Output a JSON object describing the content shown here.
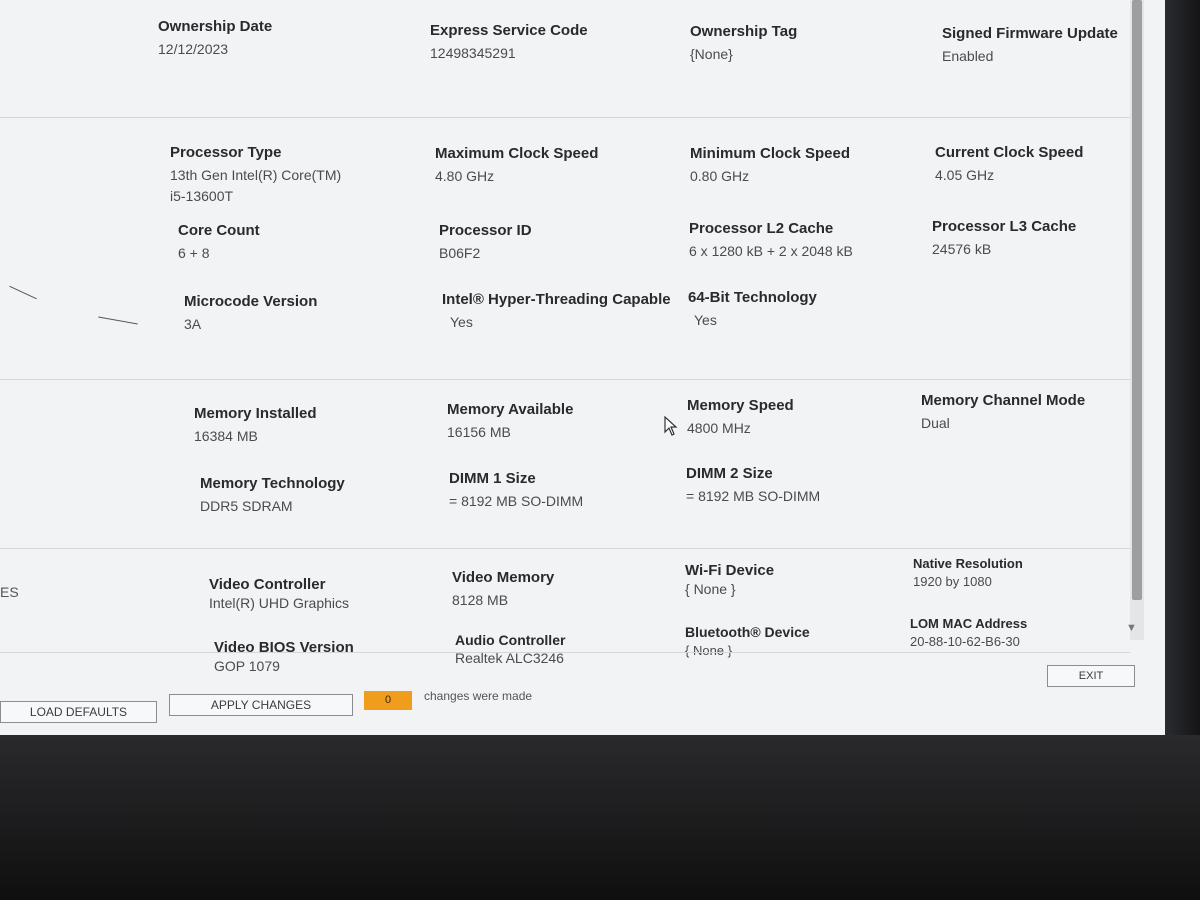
{
  "ownership": {
    "ownership_date": {
      "label": "Ownership Date",
      "value": "12/12/2023"
    },
    "express_service_code": {
      "label": "Express Service Code",
      "value": "12498345291"
    },
    "ownership_tag": {
      "label": "Ownership Tag",
      "value": "{None}"
    },
    "signed_firmware_update": {
      "label": "Signed Firmware Update",
      "value": "Enabled"
    }
  },
  "processor": {
    "processor_type": {
      "label": "Processor Type",
      "value_line1": "13th Gen Intel(R) Core(TM)",
      "value_line2": "i5-13600T"
    },
    "maximum_clock_speed": {
      "label": "Maximum Clock Speed",
      "value": "4.80 GHz"
    },
    "minimum_clock_speed": {
      "label": "Minimum Clock Speed",
      "value": "0.80 GHz"
    },
    "current_clock_speed": {
      "label": "Current Clock Speed",
      "value": "4.05 GHz"
    },
    "core_count": {
      "label": "Core Count",
      "value": "6 + 8"
    },
    "processor_id": {
      "label": "Processor ID",
      "value": "B06F2"
    },
    "l2_cache": {
      "label": "Processor L2 Cache",
      "value": "6 x 1280  kB + 2 x 2048  kB"
    },
    "l3_cache": {
      "label": "Processor L3 Cache",
      "value": "24576 kB"
    },
    "microcode_version": {
      "label": "Microcode Version",
      "value": "3A"
    },
    "hyper_threading": {
      "label": "Intel® Hyper-Threading Capable",
      "value": "Yes"
    },
    "sixty_four_bit": {
      "label": "64-Bit Technology",
      "value": "Yes"
    }
  },
  "memory": {
    "installed": {
      "label": "Memory Installed",
      "value": "16384 MB"
    },
    "available": {
      "label": "Memory Available",
      "value": "16156 MB"
    },
    "speed": {
      "label": "Memory Speed",
      "value": "4800 MHz"
    },
    "channel_mode": {
      "label": "Memory Channel Mode",
      "value": "Dual"
    },
    "technology": {
      "label": "Memory Technology",
      "value": "DDR5 SDRAM"
    },
    "dimm1": {
      "label": "DIMM 1 Size",
      "value": "= 8192 MB SO-DIMM"
    },
    "dimm2": {
      "label": "DIMM 2 Size",
      "value": "= 8192 MB SO-DIMM"
    }
  },
  "devices": {
    "video_controller": {
      "label": "Video Controller",
      "value": "Intel(R) UHD Graphics"
    },
    "video_memory": {
      "label": "Video Memory",
      "value": "8128 MB"
    },
    "wifi_device": {
      "label": "Wi-Fi Device",
      "value": "{ None }"
    },
    "native_resolution": {
      "label": "Native Resolution",
      "value": "1920 by 1080"
    },
    "video_bios": {
      "label": "Video BIOS Version",
      "value": "GOP 1079"
    },
    "audio_controller": {
      "label": "Audio Controller",
      "value": "Realtek ALC3246"
    },
    "bluetooth_device": {
      "label": "Bluetooth® Device",
      "value": "{ None }"
    },
    "lom_mac": {
      "label": "LOM MAC Address",
      "value": "20-88-10-62-B6-30"
    }
  },
  "sidebar_fragment": "ES",
  "footer": {
    "load_defaults": "LOAD DEFAULTS",
    "apply_changes": "APPLY CHANGES",
    "changes_count": "0",
    "changes_text": "changes were made",
    "exit": "EXIT"
  },
  "colors": {
    "screen_bg": "#f2f3f5",
    "counter_bg": "#f09d1e",
    "scrollbar_thumb": "#9d9ea2"
  }
}
